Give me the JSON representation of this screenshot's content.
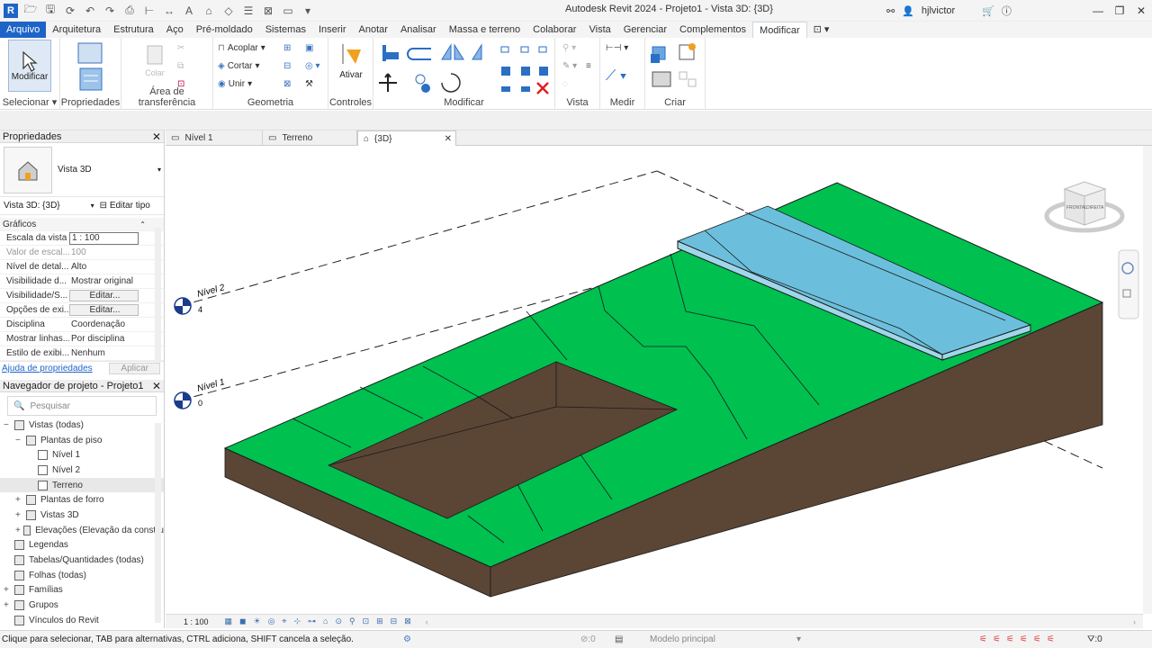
{
  "titlebar": {
    "app_title": "Autodesk Revit 2024 - Projeto1 - Vista 3D: {3D}",
    "user": "hjlvictor",
    "logo": "R"
  },
  "menu": {
    "items": [
      "Arquivo",
      "Arquitetura",
      "Estrutura",
      "Aço",
      "Pré-moldado",
      "Sistemas",
      "Inserir",
      "Anotar",
      "Analisar",
      "Massa e terreno",
      "Colaborar",
      "Vista",
      "Gerenciar",
      "Complementos",
      "Modificar"
    ],
    "active": "Modificar"
  },
  "ribbon": {
    "modify_btn": "Modificar",
    "selecionar": "Selecionar",
    "propriedades": "Propriedades",
    "area_transferencia": "Área de transferência",
    "colar": "Colar",
    "geometria": "Geometria",
    "acoplar": "Acoplar",
    "cortar": "Cortar",
    "unir": "Unir",
    "controles": "Controles",
    "ativar": "Ativar",
    "modificar_panel": "Modificar",
    "vista": "Vista",
    "medir": "Medir",
    "criar": "Criar"
  },
  "properties": {
    "header": "Propriedades",
    "type_name": "Vista 3D",
    "instance": "Vista 3D: {3D}",
    "edit_type": "Editar tipo",
    "section": "Gráficos",
    "rows": [
      {
        "k": "Escala da vista",
        "v": "1 : 100",
        "style": "box"
      },
      {
        "k": "Valor de escal...",
        "v": "100",
        "style": "dim"
      },
      {
        "k": "Nível de detal...",
        "v": "Alto",
        "style": ""
      },
      {
        "k": "Visibilidade d...",
        "v": "Mostrar original",
        "style": ""
      },
      {
        "k": "Visibilidade/S...",
        "v": "Editar...",
        "style": "btn"
      },
      {
        "k": "Opções de exi...",
        "v": "Editar...",
        "style": "btn"
      },
      {
        "k": "Disciplina",
        "v": "Coordenação",
        "style": ""
      },
      {
        "k": "Mostrar linhas...",
        "v": "Por disciplina",
        "style": ""
      },
      {
        "k": "Estilo de exibi...",
        "v": "Nenhum",
        "style": ""
      }
    ],
    "help_link": "Ajuda de propriedades",
    "apply": "Aplicar"
  },
  "browser": {
    "header": "Navegador de projeto - Projeto1",
    "search_placeholder": "Pesquisar",
    "items": [
      {
        "label": "Vistas (todas)",
        "indent": 0,
        "toggle": "−"
      },
      {
        "label": "Plantas de piso",
        "indent": 1,
        "toggle": "−"
      },
      {
        "label": "Nível 1",
        "indent": 2,
        "toggle": ""
      },
      {
        "label": "Nível 2",
        "indent": 2,
        "toggle": ""
      },
      {
        "label": "Terreno",
        "indent": 2,
        "toggle": "",
        "selected": true
      },
      {
        "label": "Plantas de forro",
        "indent": 1,
        "toggle": "+"
      },
      {
        "label": "Vistas 3D",
        "indent": 1,
        "toggle": "+"
      },
      {
        "label": "Elevações (Elevação da constru",
        "indent": 1,
        "toggle": "+"
      },
      {
        "label": "Legendas",
        "indent": 0,
        "toggle": ""
      },
      {
        "label": "Tabelas/Quantidades (todas)",
        "indent": 0,
        "toggle": ""
      },
      {
        "label": "Folhas (todas)",
        "indent": 0,
        "toggle": ""
      },
      {
        "label": "Famílias",
        "indent": 0,
        "toggle": "+"
      },
      {
        "label": "Grupos",
        "indent": 0,
        "toggle": "+"
      },
      {
        "label": "Vínculos do Revit",
        "indent": 0,
        "toggle": ""
      }
    ]
  },
  "view_tabs": [
    {
      "label": "Nível 1",
      "active": false
    },
    {
      "label": "Terreno",
      "active": false
    },
    {
      "label": "{3D}",
      "active": true
    }
  ],
  "canvas": {
    "level2_name": "Nível 2",
    "level2_value": "4",
    "level1_name": "Nível 1",
    "level1_value": "0",
    "viewcube_front": "FRONTAL",
    "viewcube_right": "DIREITA",
    "colors": {
      "terrain": "#00c050",
      "soil": "#5b4535",
      "water": "#6cbfdc",
      "edge": "#1a1a1a"
    }
  },
  "viewbar": {
    "scale": "1 : 100"
  },
  "status": {
    "message": "Clique para selecionar, TAB para alternativas, CTRL adiciona, SHIFT cancela a seleção.",
    "workset_value": ":0",
    "model": "Modelo principal",
    "filter_value": ":0"
  }
}
